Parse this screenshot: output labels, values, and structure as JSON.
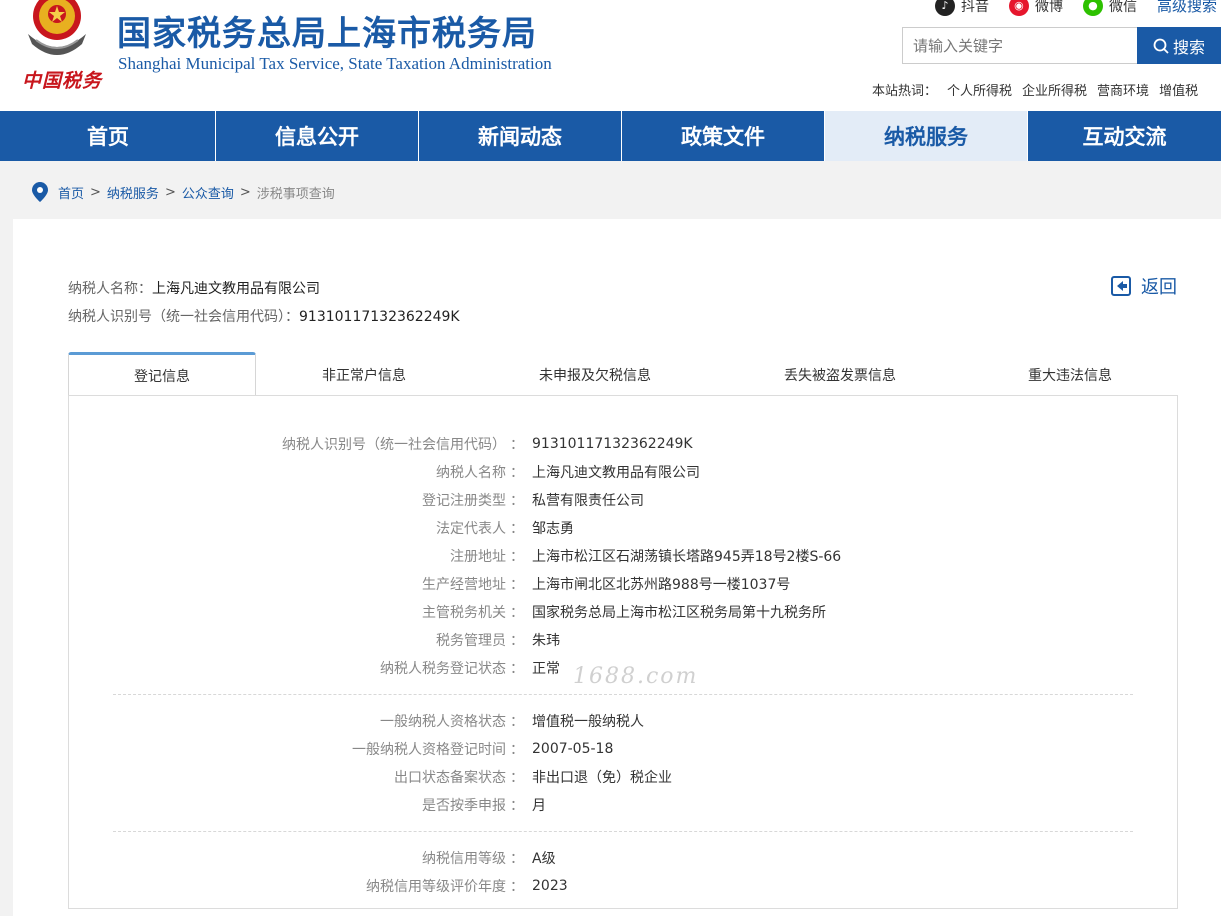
{
  "header": {
    "title": "国家税务总局上海市税务局",
    "subtitle": "Shanghai Municipal Tax Service, State Taxation Administration",
    "logo_text": "中国税务",
    "social": [
      {
        "label": "抖音",
        "icon": "douyin-icon",
        "color": "#222222"
      },
      {
        "label": "微博",
        "icon": "weibo-icon",
        "color": "#e6162d"
      },
      {
        "label": "微信",
        "icon": "wechat-icon",
        "color": "#2dc100"
      }
    ],
    "advanced_search": "高级搜索",
    "search_placeholder": "请输入关键字",
    "search_button": "搜索",
    "hotwords_label": "本站热词：",
    "hotwords": [
      "个人所得税",
      "企业所得税",
      "营商环境",
      "增值税"
    ]
  },
  "nav": [
    {
      "label": "首页",
      "active": false
    },
    {
      "label": "信息公开",
      "active": false
    },
    {
      "label": "新闻动态",
      "active": false
    },
    {
      "label": "政策文件",
      "active": false
    },
    {
      "label": "纳税服务",
      "active": true
    },
    {
      "label": "互动交流",
      "active": false
    }
  ],
  "breadcrumb": {
    "items": [
      "首页",
      "纳税服务",
      "公众查询"
    ],
    "current": "涉税事项查询",
    "separator": ">"
  },
  "taxpayer": {
    "name_label": "纳税人名称：",
    "name": "上海凡迪文教用品有限公司",
    "id_label": "纳税人识别号（统一社会信用代码）：",
    "id": "91310117132362249K"
  },
  "back_label": "返回",
  "tabs": [
    "登记信息",
    "非正常户信息",
    "未申报及欠税信息",
    "丢失被盗发票信息",
    "重大违法信息"
  ],
  "registration": {
    "group1": [
      {
        "key": "纳税人识别号（统一社会信用代码）",
        "value": "91310117132362249K"
      },
      {
        "key": "纳税人名称",
        "value": "上海凡迪文教用品有限公司"
      },
      {
        "key": "登记注册类型",
        "value": "私营有限责任公司"
      },
      {
        "key": "法定代表人",
        "value": "邹志勇"
      },
      {
        "key": "注册地址",
        "value": "上海市松江区石湖荡镇长塔路945弄18号2楼S-66"
      },
      {
        "key": "生产经营地址",
        "value": "上海市闸北区北苏州路988号一楼1037号"
      },
      {
        "key": "主管税务机关",
        "value": "国家税务总局上海市松江区税务局第十九税务所"
      },
      {
        "key": "税务管理员",
        "value": "朱玮"
      },
      {
        "key": "纳税人税务登记状态",
        "value": "正常"
      }
    ],
    "group2": [
      {
        "key": "一般纳税人资格状态",
        "value": "增值税一般纳税人"
      },
      {
        "key": "一般纳税人资格登记时间",
        "value": "2007-05-18"
      },
      {
        "key": "出口状态备案状态",
        "value": "非出口退（免）税企业"
      },
      {
        "key": "是否按季申报",
        "value": "月"
      }
    ],
    "group3": [
      {
        "key": "纳税信用等级",
        "value": "A级"
      },
      {
        "key": "纳税信用等级评价年度",
        "value": "2023"
      }
    ]
  },
  "watermark": "1688.com",
  "colors": {
    "brand": "#1a5aa6",
    "accent_red": "#c8161d"
  }
}
